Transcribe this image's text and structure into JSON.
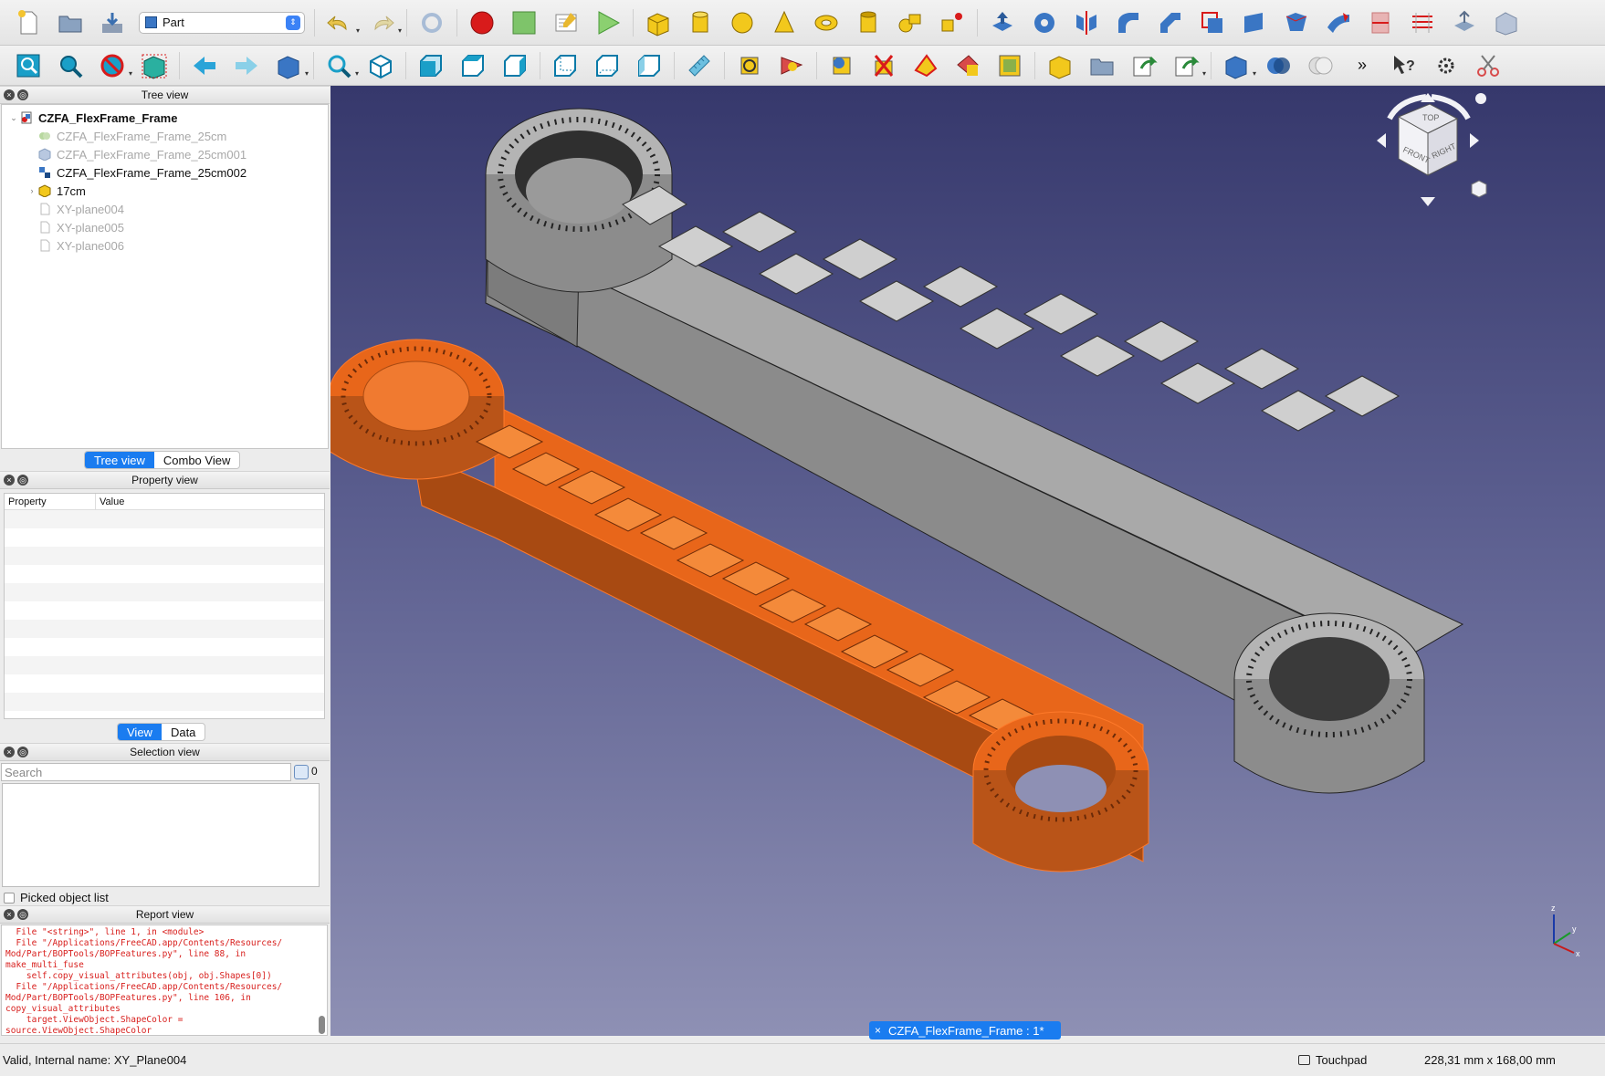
{
  "toolbar": {
    "workbench": "Part",
    "row1_icons": [
      "new-document-icon",
      "open-folder-icon",
      "save-icon",
      "undo-icon",
      "redo-icon",
      "refresh-icon",
      "record-macro-icon",
      "stop-macro-icon",
      "edit-macro-icon",
      "run-macro-icon",
      "box-icon",
      "cylinder-icon",
      "sphere-icon",
      "cone-icon",
      "torus-icon",
      "tube-icon",
      "primitives-icon",
      "shape-builder-icon",
      "extrude-icon",
      "revolve-icon",
      "mirror-icon",
      "fillet-icon",
      "chamfer-icon",
      "make-face-icon",
      "ruled-surface-icon",
      "loft-icon",
      "sweep-icon",
      "section-icon",
      "cross-sections-icon",
      "offset-icon",
      "thickness-icon"
    ],
    "row2_icons": [
      "fit-all-icon",
      "fit-selection-icon",
      "draw-style-icon",
      "bounding-box-icon",
      "back-icon",
      "forward-icon",
      "std-views-icon",
      "zoom-icon",
      "isometric-view-icon",
      "front-view-icon",
      "top-view-icon",
      "right-view-icon",
      "rear-view-icon",
      "bottom-view-icon",
      "left-view-icon",
      "measure-icon",
      "measure-linear-icon",
      "measure-angular-icon",
      "measure-refresh-icon",
      "measure-clear-icon",
      "measure-toggle-all-icon",
      "measure-toggle-3d-icon",
      "measure-toggle-delta-icon",
      "part-icon",
      "group-icon",
      "link-icon",
      "link-actions-icon",
      "box-selection-icon",
      "boolean-icon",
      "union-icon",
      "whats-this-icon",
      "settings-icon",
      "cut-icon"
    ]
  },
  "tree": {
    "title": "Tree view",
    "items": [
      {
        "label": "CZFA_FlexFrame_Frame",
        "style": "bold"
      },
      {
        "label": "CZFA_FlexFrame_Frame_25cm",
        "style": "dim"
      },
      {
        "label": "CZFA_FlexFrame_Frame_25cm001",
        "style": "dim"
      },
      {
        "label": "CZFA_FlexFrame_Frame_25cm002",
        "style": "normal"
      },
      {
        "label": "17cm",
        "style": "normal"
      },
      {
        "label": "XY-plane004",
        "style": "dim"
      },
      {
        "label": "XY-plane005",
        "style": "dim"
      },
      {
        "label": "XY-plane006",
        "style": "dim"
      }
    ],
    "tabs": [
      "Tree view",
      "Combo View"
    ]
  },
  "property": {
    "title": "Property view",
    "col_property": "Property",
    "col_value": "Value",
    "tabs": [
      "View",
      "Data"
    ]
  },
  "selection": {
    "title": "Selection view",
    "search_placeholder": "Search",
    "count": "0",
    "picked_label": "Picked object list"
  },
  "report": {
    "title": "Report view",
    "text": "  File \"<string>\", line 1, in <module>\n  File \"/Applications/FreeCAD.app/Contents/Resources/\nMod/Part/BOPTools/BOPFeatures.py\", line 88, in\nmake_multi_fuse\n    self.copy_visual_attributes(obj, obj.Shapes[0])\n  File \"/Applications/FreeCAD.app/Contents/Resources/\nMod/Part/BOPTools/BOPFeatures.py\", line 106, in\ncopy_visual_attributes\n    target.ViewObject.ShapeColor =\nsource.ViewObject.ShapeColor\n<class 'AttributeError'>: 'Gui.ViewProviderLink' object"
  },
  "viewport": {
    "document_tab": "CZFA_FlexFrame_Frame : 1*",
    "navcube": {
      "top": "TOP",
      "front": "FRONT",
      "right": "RIGHT"
    },
    "axis": {
      "x": "x",
      "y": "y",
      "z": "z"
    },
    "colors": {
      "selected": "#e8661a",
      "model": "#a9a9a9",
      "bg_top": "#36386c",
      "bg_bottom": "#8e90b4"
    }
  },
  "status": {
    "text": "Valid, Internal name: XY_Plane004",
    "navigation": "Touchpad",
    "dimensions": "228,31 mm x 168,00 mm"
  }
}
